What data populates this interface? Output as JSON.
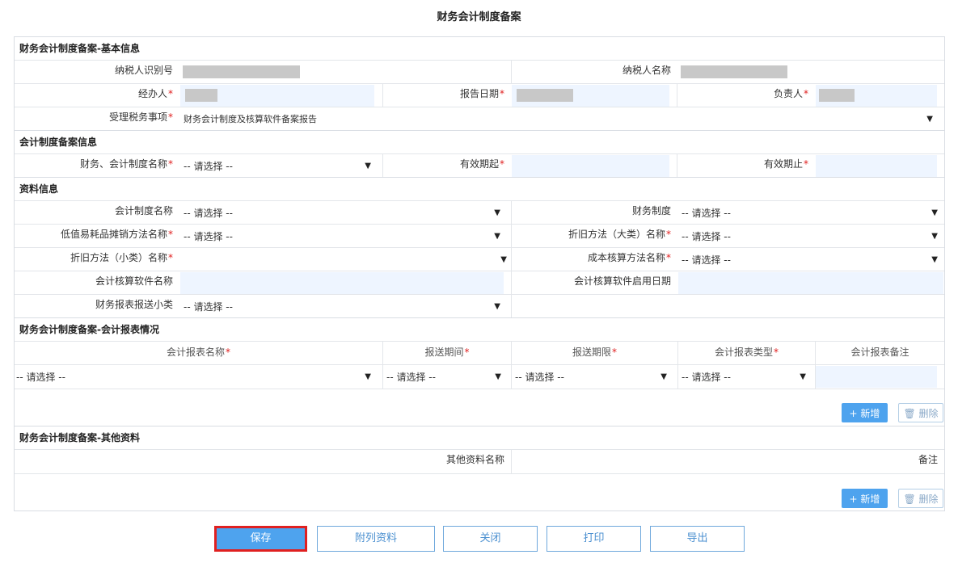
{
  "page_title": "财务会计制度备案",
  "sections": {
    "basic": "财务会计制度备案-基本信息",
    "policy": "会计制度备案信息",
    "material": "资料信息",
    "reports": "财务会计制度备案-会计报表情况",
    "other": "财务会计制度备案-其他资料"
  },
  "basic": {
    "taxpayer_id_label": "纳税人识别号",
    "taxpayer_name_label": "纳税人名称",
    "handler_label": "经办人",
    "report_date_label": "报告日期",
    "person_in_charge_label": "负责人",
    "matter_label": "受理税务事项",
    "matter_value": "财务会计制度及核算软件备案报告"
  },
  "policy": {
    "name_label": "财务、会计制度名称",
    "name_value": "-- 请选择 --",
    "valid_from_label": "有效期起",
    "valid_to_label": "有效期止"
  },
  "material": {
    "acct_system_label": "会计制度名称",
    "acct_system_value": "-- 请选择 --",
    "finance_system_label": "财务制度",
    "finance_system_value": "-- 请选择 --",
    "low_value_label": "低值易耗品摊销方法名称",
    "low_value_value": "-- 请选择 --",
    "dep_major_label": "折旧方法（大类）名称",
    "dep_major_value": "-- 请选择 --",
    "dep_minor_label": "折旧方法（小类）名称",
    "cost_method_label": "成本核算方法名称",
    "cost_method_value": "-- 请选择 --",
    "software_name_label": "会计核算软件名称",
    "software_date_label": "会计核算软件启用日期",
    "report_sub_label": "财务报表报送小类",
    "report_sub_value": "-- 请选择 --"
  },
  "reports": {
    "headers": [
      "会计报表名称",
      "报送期间",
      "报送期限",
      "会计报表类型",
      "会计报表备注"
    ],
    "row_values": [
      "-- 请选择 --",
      "-- 请选择 --",
      "-- 请选择 --",
      "-- 请选择 --"
    ],
    "add_label": "新增",
    "delete_label": "删除"
  },
  "other": {
    "headers": [
      "其他资料名称",
      "备注"
    ],
    "add_label": "新增",
    "delete_label": "删除"
  },
  "req_mark": "*",
  "arrow": "▼",
  "buttons": {
    "save": "保存",
    "attachments": "附列资料",
    "close": "关闭",
    "print": "打印",
    "export": "导出"
  }
}
